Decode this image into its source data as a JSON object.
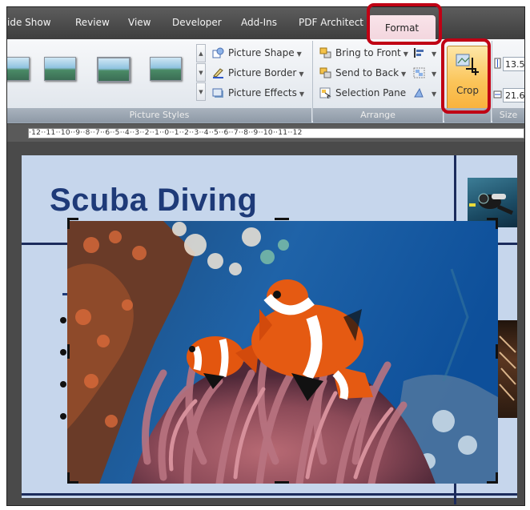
{
  "tabs": {
    "slide_show": "ide Show",
    "review": "Review",
    "view": "View",
    "developer": "Developer",
    "add_ins": "Add-Ins",
    "pdf_architect": "PDF Architect",
    "format": "Format"
  },
  "ribbon": {
    "picture_styles": {
      "group_label": "Picture Styles",
      "picture_shape": "Picture Shape",
      "picture_border": "Picture Border",
      "picture_effects": "Picture Effects"
    },
    "arrange": {
      "group_label": "Arrange",
      "bring_to_front": "Bring to Front",
      "send_to_back": "Send to Back",
      "selection_pane": "Selection Pane"
    },
    "crop_label": "Crop",
    "size": {
      "group_label": "Size",
      "height": "13.5",
      "width": "21.6"
    }
  },
  "ruler": {
    "text": "·12··11··10··9··8··7··6··5··4··3··2··1··0··1··2··3··4··5··6··7··8··9··10··11··12"
  },
  "slide": {
    "title": "Scuba Diving"
  },
  "colors": {
    "annotation": "#c00014",
    "slide_background": "#c6d6ec",
    "title": "#1e3a78",
    "crop_highlight": "#fbc55a"
  }
}
